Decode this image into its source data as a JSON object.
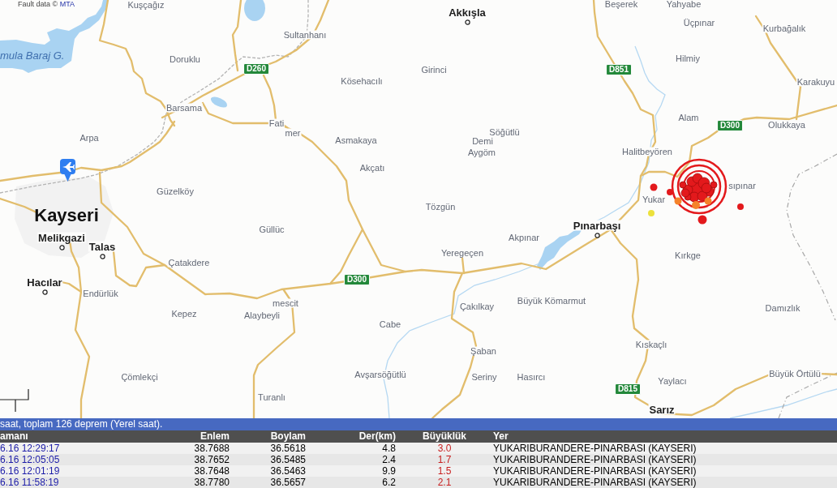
{
  "map": {
    "attribution": {
      "text": "Fault data ©",
      "link": "MTA"
    },
    "lake_label": "mula Baraj G.",
    "places": [
      {
        "name": "Kuşçağız",
        "kind": "village"
      },
      {
        "name": "Akkışla",
        "kind": "town"
      },
      {
        "name": "Beşerek",
        "kind": "village"
      },
      {
        "name": "Yahyabe",
        "kind": "village"
      },
      {
        "name": "Üçpınar",
        "kind": "village"
      },
      {
        "name": "Kurbağalık",
        "kind": "village"
      },
      {
        "name": "Sultanhanı",
        "kind": "village"
      },
      {
        "name": "Doruklu",
        "kind": "village"
      },
      {
        "name": "Hilmiy",
        "kind": "village"
      },
      {
        "name": "Girinci",
        "kind": "village"
      },
      {
        "name": "Kösehacılı",
        "kind": "village"
      },
      {
        "name": "Karakuyu",
        "kind": "village"
      },
      {
        "name": "Barsama",
        "kind": "village"
      },
      {
        "name": "Alam",
        "kind": "village"
      },
      {
        "name": "Fati",
        "kind": "village"
      },
      {
        "name": "Olukkaya",
        "kind": "village"
      },
      {
        "name": "Söğütlü",
        "kind": "village"
      },
      {
        "name": "mer",
        "kind": "village"
      },
      {
        "name": "Arpa",
        "kind": "village"
      },
      {
        "name": "Asmakaya",
        "kind": "village"
      },
      {
        "name": "Demi",
        "kind": "village"
      },
      {
        "name": "Aygöm",
        "kind": "village"
      },
      {
        "name": "Halitbeyören",
        "kind": "village"
      },
      {
        "name": "Akçatı",
        "kind": "village"
      },
      {
        "name": "sıpınar",
        "kind": "village"
      },
      {
        "name": "Güzelköy",
        "kind": "village"
      },
      {
        "name": "Yukar",
        "kind": "village"
      },
      {
        "name": "Tözgün",
        "kind": "village"
      },
      {
        "name": "Kayseri",
        "kind": "city"
      },
      {
        "name": "Pınarbaşı",
        "kind": "town"
      },
      {
        "name": "Güllüc",
        "kind": "village"
      },
      {
        "name": "Melikgazi",
        "kind": "town"
      },
      {
        "name": "Akpınar",
        "kind": "village"
      },
      {
        "name": "Talas",
        "kind": "town"
      },
      {
        "name": "Yeregeçen",
        "kind": "village"
      },
      {
        "name": "Kırkge",
        "kind": "village"
      },
      {
        "name": "Çatakdere",
        "kind": "village"
      },
      {
        "name": "Hacılar",
        "kind": "town"
      },
      {
        "name": "Endürlük",
        "kind": "village"
      },
      {
        "name": "mescit",
        "kind": "village"
      },
      {
        "name": "Çakılkay",
        "kind": "village"
      },
      {
        "name": "Büyük Kömarmut",
        "kind": "village"
      },
      {
        "name": "Damızlık",
        "kind": "village"
      },
      {
        "name": "Kepez",
        "kind": "village"
      },
      {
        "name": "Alaybeyli",
        "kind": "village"
      },
      {
        "name": "Cabe",
        "kind": "village"
      },
      {
        "name": "Kıskaçlı",
        "kind": "village"
      },
      {
        "name": "Şaban",
        "kind": "village"
      },
      {
        "name": "Çömlekçi",
        "kind": "village"
      },
      {
        "name": "Avşarsöğütlü",
        "kind": "village"
      },
      {
        "name": "Seriny",
        "kind": "village"
      },
      {
        "name": "Hasırcı",
        "kind": "village"
      },
      {
        "name": "Yaylacı",
        "kind": "village"
      },
      {
        "name": "Büyük Örtülü",
        "kind": "village"
      },
      {
        "name": "Turanlı",
        "kind": "village"
      },
      {
        "name": "Sarız",
        "kind": "bold"
      }
    ],
    "road_labels": [
      "D260",
      "D851",
      "D300",
      "D300",
      "D815"
    ],
    "earthquakes": [
      {
        "kind": "rings",
        "color": "#e3191c"
      },
      {
        "kind": "dot",
        "color": "#e3191c"
      },
      {
        "kind": "dot",
        "color": "#e3191c"
      },
      {
        "kind": "dot",
        "color": "#ece13c"
      },
      {
        "kind": "dot",
        "color": "#e3191c"
      },
      {
        "kind": "dot",
        "color": "#e3191c"
      },
      {
        "kind": "dot",
        "color": "#f5822a"
      },
      {
        "kind": "dot",
        "color": "#f5822a"
      },
      {
        "kind": "dot",
        "color": "#f5822a"
      }
    ]
  },
  "events": {
    "summary": "saat, toplam 126 deprem (Yerel saat).",
    "columns": [
      "amanı",
      "Enlem",
      "Boylam",
      "Der(km)",
      "Büyüklük",
      "Yer"
    ],
    "rows": [
      {
        "cells": [
          "6.16 12:29:17",
          "38.7688",
          "36.5618",
          "4.8",
          "3.0",
          "YUKARIBURANDERE-PINARBASI (KAYSERI)"
        ]
      },
      {
        "cells": [
          "6.16 12:05:05",
          "38.7652",
          "36.5485",
          "2.4",
          "1.7",
          "YUKARIBURANDERE-PINARBASI (KAYSERI)"
        ]
      },
      {
        "cells": [
          "6.16 12:01:19",
          "38.7648",
          "36.5463",
          "9.9",
          "1.5",
          "YUKARIBURANDERE-PINARBASI (KAYSERI)"
        ]
      },
      {
        "cells": [
          "6.16 11:58:19",
          "38.7780",
          "36.5657",
          "6.2",
          "2.1",
          "YUKARIBURANDERE-PINARBASI (KAYSERI)"
        ]
      }
    ]
  }
}
